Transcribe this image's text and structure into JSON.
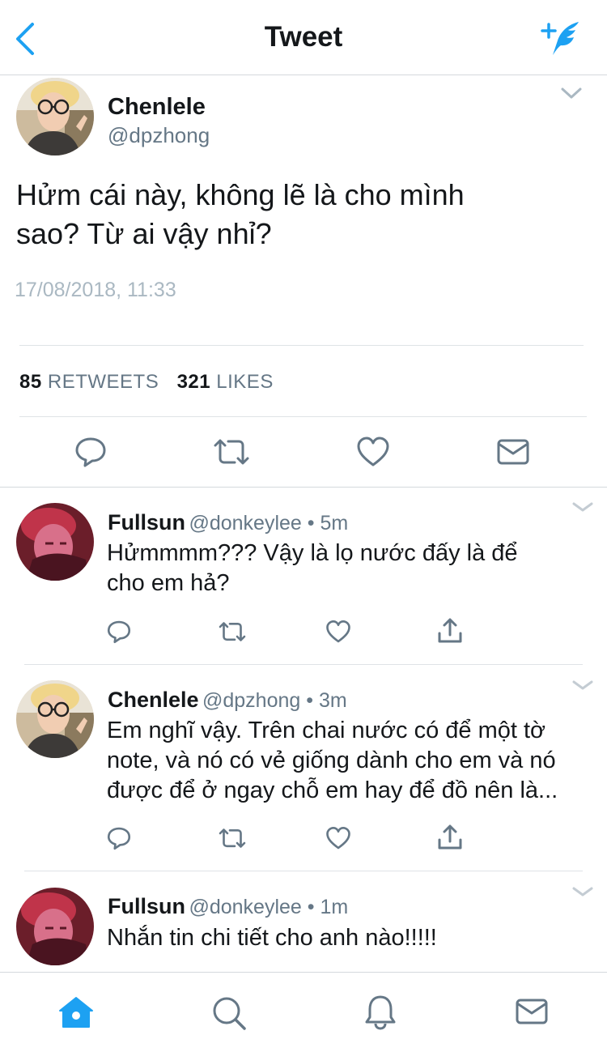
{
  "header": {
    "title": "Tweet",
    "back_icon": "chevron-left-icon",
    "compose_icon": "compose-tweet-icon",
    "accent_color": "#1da1f2"
  },
  "main_tweet": {
    "display_name": "Chenlele",
    "handle": "@dpzhong",
    "text_line1": "Hửm cái này, không lẽ là cho mình",
    "text_line2": "sao? Từ ai vậy nhỉ?",
    "timestamp": "17/08/2018, 11:33",
    "retweets_count": "85",
    "retweets_label": "RETWEETS",
    "likes_count": "321",
    "likes_label": "LIKES",
    "actions": [
      "reply-icon",
      "retweet-icon",
      "like-icon",
      "message-icon"
    ]
  },
  "replies": [
    {
      "display_name": "Fullsun",
      "meta": "@donkeylee • 5m",
      "lines": [
        "Hửmmmm??? Vậy là lọ nước đấy là để",
        "cho em hả?"
      ]
    },
    {
      "display_name": "Chenlele",
      "meta": "@dpzhong • 3m",
      "lines": [
        "Em nghĩ vậy. Trên chai nước có để một tờ",
        "note, và nó có vẻ giống dành cho em và nó",
        "được để ở ngay chỗ em hay để đồ nên là..."
      ]
    },
    {
      "display_name": "Fullsun",
      "meta": "@donkeylee • 1m",
      "lines": [
        "Nhắn tin chi tiết cho anh nào!!!!!"
      ]
    }
  ],
  "tabbar": {
    "items": [
      "home-icon",
      "search-icon",
      "notifications-icon",
      "messages-icon"
    ],
    "active": "home-icon"
  }
}
